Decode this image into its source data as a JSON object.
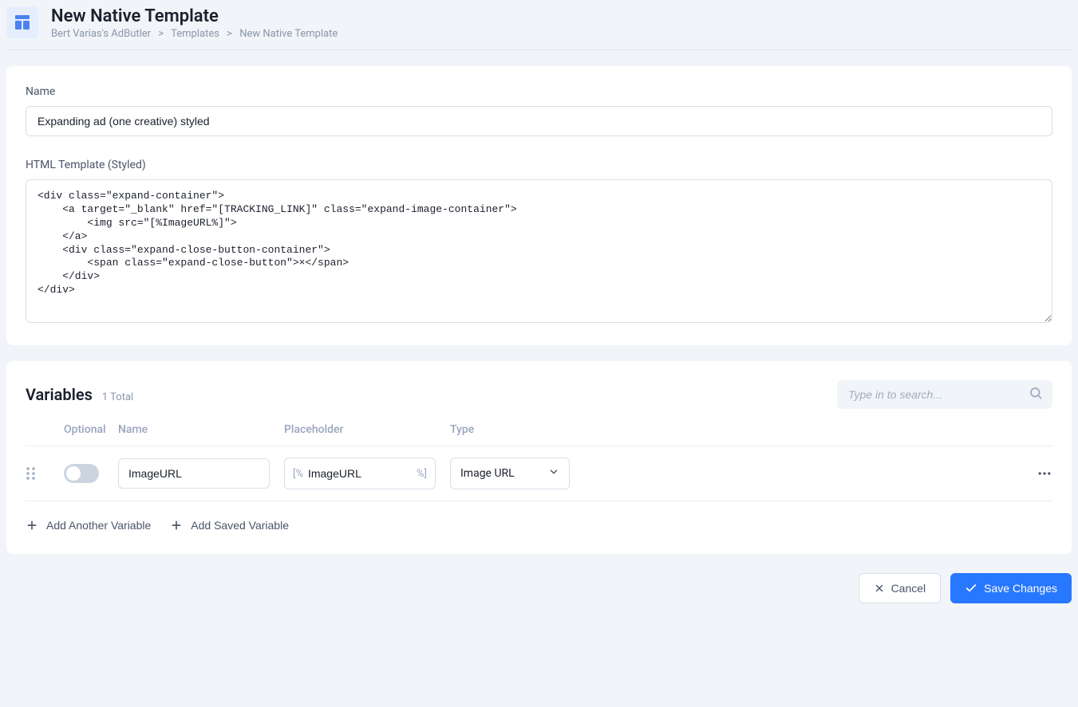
{
  "header": {
    "title": "New Native Template",
    "breadcrumb": {
      "root": "Bert Varias's AdButler",
      "mid": "Templates",
      "current": "New Native Template"
    }
  },
  "form": {
    "name_label": "Name",
    "name_value": "Expanding ad (one creative) styled",
    "html_label": "HTML Template (Styled)",
    "html_value": "<div class=\"expand-container\">\n    <a target=\"_blank\" href=\"[TRACKING_LINK]\" class=\"expand-image-container\">\n        <img src=\"[%ImageURL%]\">\n    </a>\n    <div class=\"expand-close-button-container\">\n        <span class=\"expand-close-button\">×</span>\n    </div>\n</div>"
  },
  "variables": {
    "title": "Variables",
    "count_label": "1 Total",
    "search_placeholder": "Type in to search...",
    "columns": {
      "optional": "Optional",
      "name": "Name",
      "placeholder": "Placeholder",
      "type": "Type"
    },
    "rows": [
      {
        "name": "ImageURL",
        "placeholder": "ImageURL",
        "type": "Image URL"
      }
    ],
    "add_variable_label": "Add Another Variable",
    "add_saved_label": "Add Saved Variable"
  },
  "footer": {
    "cancel_label": "Cancel",
    "save_label": "Save Changes"
  }
}
